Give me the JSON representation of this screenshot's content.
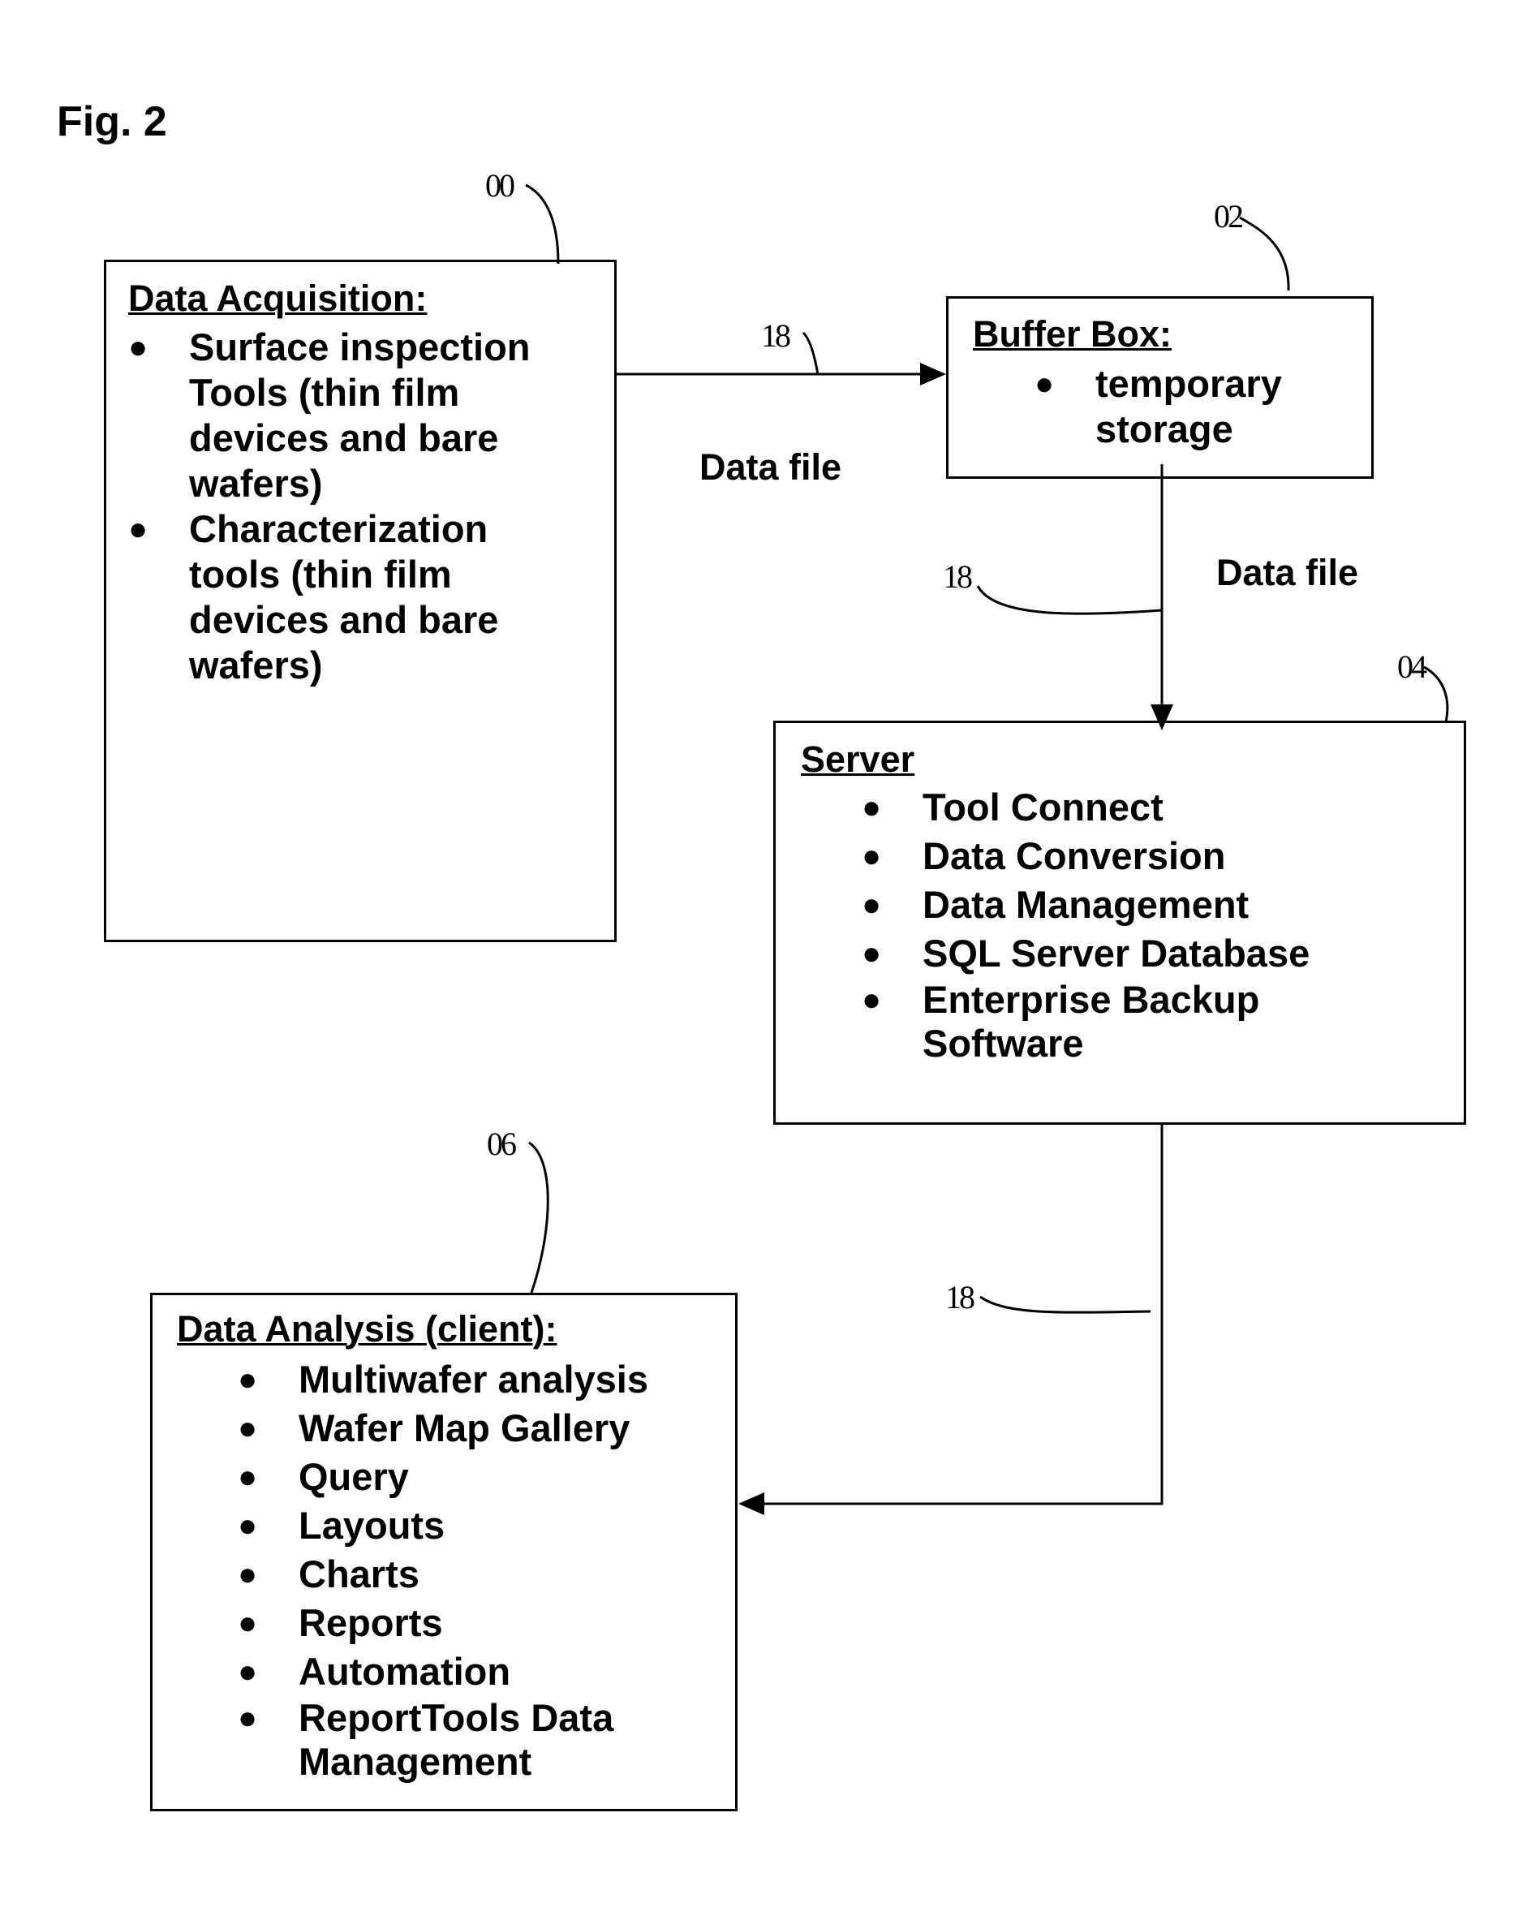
{
  "figure_label": "Fig. 2",
  "boxes": {
    "acquisition": {
      "ref": "00",
      "title": "Data Acquisition:",
      "items": [
        [
          "Surface inspection",
          "Tools (thin film",
          "devices and bare",
          "wafers)"
        ],
        [
          "Characterization",
          "tools (thin film",
          "devices and bare",
          "wafers)"
        ]
      ]
    },
    "buffer": {
      "ref": "02",
      "title": "Buffer Box:",
      "items": [
        [
          "temporary",
          "storage"
        ]
      ]
    },
    "server": {
      "ref": "04",
      "title": "Server",
      "items": [
        [
          "Tool Connect"
        ],
        [
          "Data Conversion"
        ],
        [
          "Data Management"
        ],
        [
          "SQL Server Database"
        ],
        [
          "Enterprise Backup",
          "Software"
        ]
      ]
    },
    "analysis": {
      "ref": "06",
      "title": "Data Analysis (client):",
      "items": [
        [
          "Multiwafer analysis"
        ],
        [
          "Wafer Map Gallery"
        ],
        [
          "Query"
        ],
        [
          "Layouts"
        ],
        [
          "Charts"
        ],
        [
          "Reports"
        ],
        [
          "Automation"
        ],
        [
          "ReportTools Data",
          "Management"
        ]
      ]
    }
  },
  "connections": [
    {
      "ref": "18",
      "label": "Data file"
    },
    {
      "ref": "18",
      "label": "Data file"
    },
    {
      "ref": "18",
      "label": ""
    }
  ]
}
